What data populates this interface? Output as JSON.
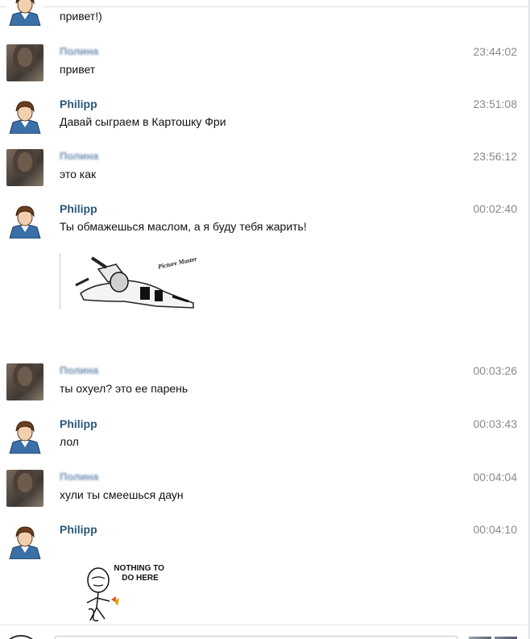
{
  "messages": [
    {
      "author": "",
      "avatar": "man",
      "time": "",
      "text": "привет!)"
    },
    {
      "author": "Полина",
      "avatar": "woman",
      "time": "23:44:02",
      "text": "привет"
    },
    {
      "author": "Philipp",
      "avatar": "man",
      "time": "23:51:08",
      "text": "Давай сыграем в Картошку Фри"
    },
    {
      "author": "Полина",
      "avatar": "woman",
      "time": "23:56:12",
      "text": "это как"
    },
    {
      "author": "Philipp",
      "avatar": "man",
      "time": "00:02:40",
      "text": "Ты обмажешься маслом, а я буду тебя жарить!"
    },
    {
      "author": "Полина",
      "avatar": "woman",
      "time": "00:03:26",
      "text": "ты охуел? это ее парень"
    },
    {
      "author": "Philipp",
      "avatar": "man",
      "time": "00:03:43",
      "text": "лол"
    },
    {
      "author": "Полина",
      "avatar": "woman",
      "time": "00:04:04",
      "text": "хули ты смеешься даун"
    },
    {
      "author": "Philipp",
      "avatar": "man",
      "time": "00:04:10",
      "text": ""
    }
  ],
  "attachments": {
    "fry_image_caption": "Picture Master",
    "nothing_image_caption": "NOTHING TO DO HERE"
  },
  "colors": {
    "author_link": "#2b587a",
    "timestamp": "#8a8a8a",
    "input_border": "#c0cad5"
  }
}
